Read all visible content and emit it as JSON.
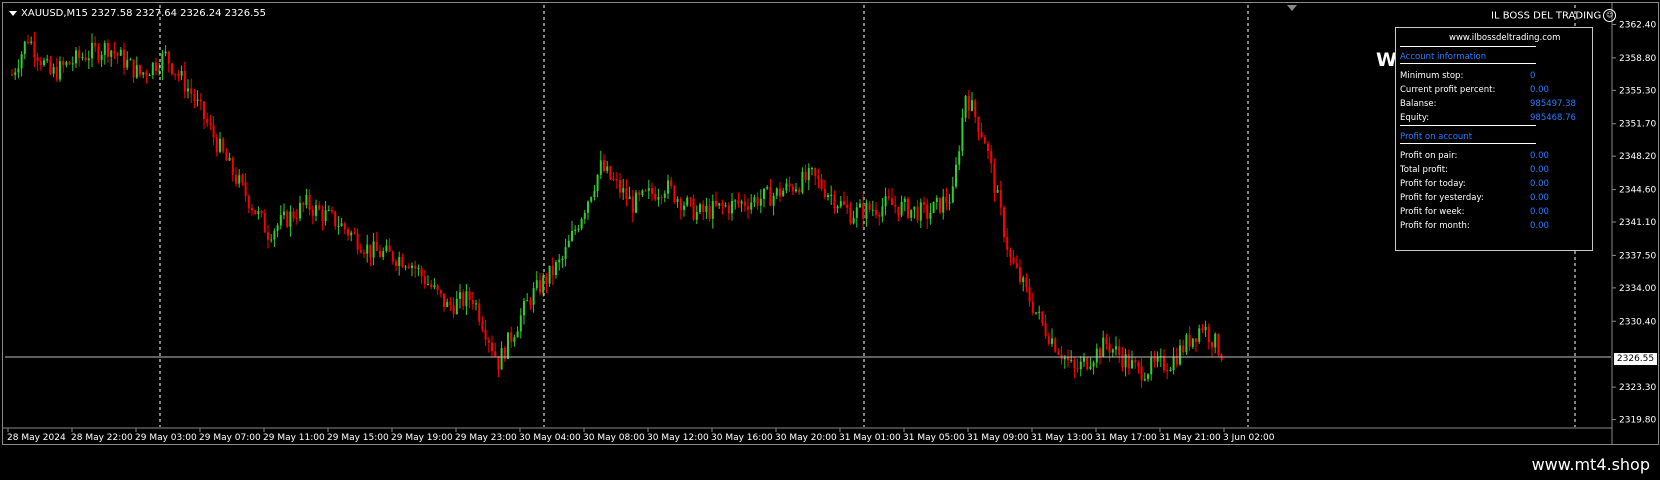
{
  "symbol_title": "XAUUSD,M15  2327.58 2327.64 2326.24 2326.55",
  "brand": "IL BOSS DEL TRADING",
  "big_letter": "W",
  "footer": "www.mt4.shop",
  "current_price": "2326.55",
  "colors": {
    "bull": "#32cd32",
    "bear": "#ff0000",
    "grid": "#ffffff",
    "accent": "#2a7bff",
    "background": "#000000"
  },
  "panel": {
    "site": "www.ilbossdeltrading.com",
    "account_header": "Account information",
    "account_rows": [
      {
        "label": "Minimum stop:",
        "value": "0"
      },
      {
        "label": "Current profit percent:",
        "value": "0.00"
      },
      {
        "label": "Balanse:",
        "value": "985497.38"
      },
      {
        "label": "Equity:",
        "value": "985468.76"
      }
    ],
    "profit_header": "Profit on account",
    "profit_rows": [
      {
        "label": "Profit on pair:",
        "value": "0.00"
      },
      {
        "label": "Total profit:",
        "value": "0.00"
      },
      {
        "label": "Profit for today:",
        "value": "0.00"
      },
      {
        "label": "Profit for yesterday:",
        "value": "0.00"
      },
      {
        "label": "Profit for week:",
        "value": "0.00"
      },
      {
        "label": "Profit for month:",
        "value": "0.00"
      }
    ]
  },
  "chart_data": {
    "type": "candlestick",
    "ylim": [
      2319.0,
      2364.5
    ],
    "y_ticks": [
      "2362.40",
      "2358.80",
      "2355.30",
      "2351.70",
      "2348.20",
      "2344.60",
      "2341.10",
      "2337.50",
      "2334.00",
      "2330.40",
      "2323.30",
      "2319.80"
    ],
    "x_ticks": [
      "28 May 2024",
      "28 May 22:00",
      "29 May 03:00",
      "29 May 07:00",
      "29 May 11:00",
      "29 May 15:00",
      "29 May 19:00",
      "29 May 23:00",
      "30 May 04:00",
      "30 May 08:00",
      "30 May 12:00",
      "30 May 16:00",
      "30 May 20:00",
      "31 May 01:00",
      "31 May 05:00",
      "31 May 09:00",
      "31 May 13:00",
      "31 May 17:00",
      "31 May 21:00",
      "3 Jun 02:00"
    ],
    "day_separators": [
      "28 May 22:00",
      "29 May 23:00",
      "30 May 20:00",
      "31 May 21:00"
    ],
    "current_price": 2326.55,
    "anchors": [
      [
        0,
        2357
      ],
      [
        5,
        2361
      ],
      [
        12,
        2357
      ],
      [
        22,
        2359
      ],
      [
        30,
        2360
      ],
      [
        40,
        2357
      ],
      [
        48,
        2359
      ],
      [
        56,
        2355
      ],
      [
        68,
        2347
      ],
      [
        80,
        2340
      ],
      [
        92,
        2343
      ],
      [
        102,
        2341
      ],
      [
        112,
        2338
      ],
      [
        124,
        2337
      ],
      [
        136,
        2332
      ],
      [
        144,
        2333
      ],
      [
        152,
        2326
      ],
      [
        162,
        2333
      ],
      [
        172,
        2337
      ],
      [
        184,
        2347
      ],
      [
        194,
        2343
      ],
      [
        204,
        2345
      ],
      [
        214,
        2342
      ],
      [
        226,
        2343
      ],
      [
        238,
        2344
      ],
      [
        250,
        2346
      ],
      [
        262,
        2342
      ],
      [
        274,
        2343
      ],
      [
        286,
        2342
      ],
      [
        294,
        2344
      ],
      [
        298,
        2355
      ],
      [
        304,
        2350
      ],
      [
        312,
        2337
      ],
      [
        322,
        2330
      ],
      [
        332,
        2325
      ],
      [
        342,
        2328
      ],
      [
        352,
        2325
      ],
      [
        362,
        2326
      ],
      [
        372,
        2330
      ],
      [
        378,
        2327
      ]
    ]
  }
}
